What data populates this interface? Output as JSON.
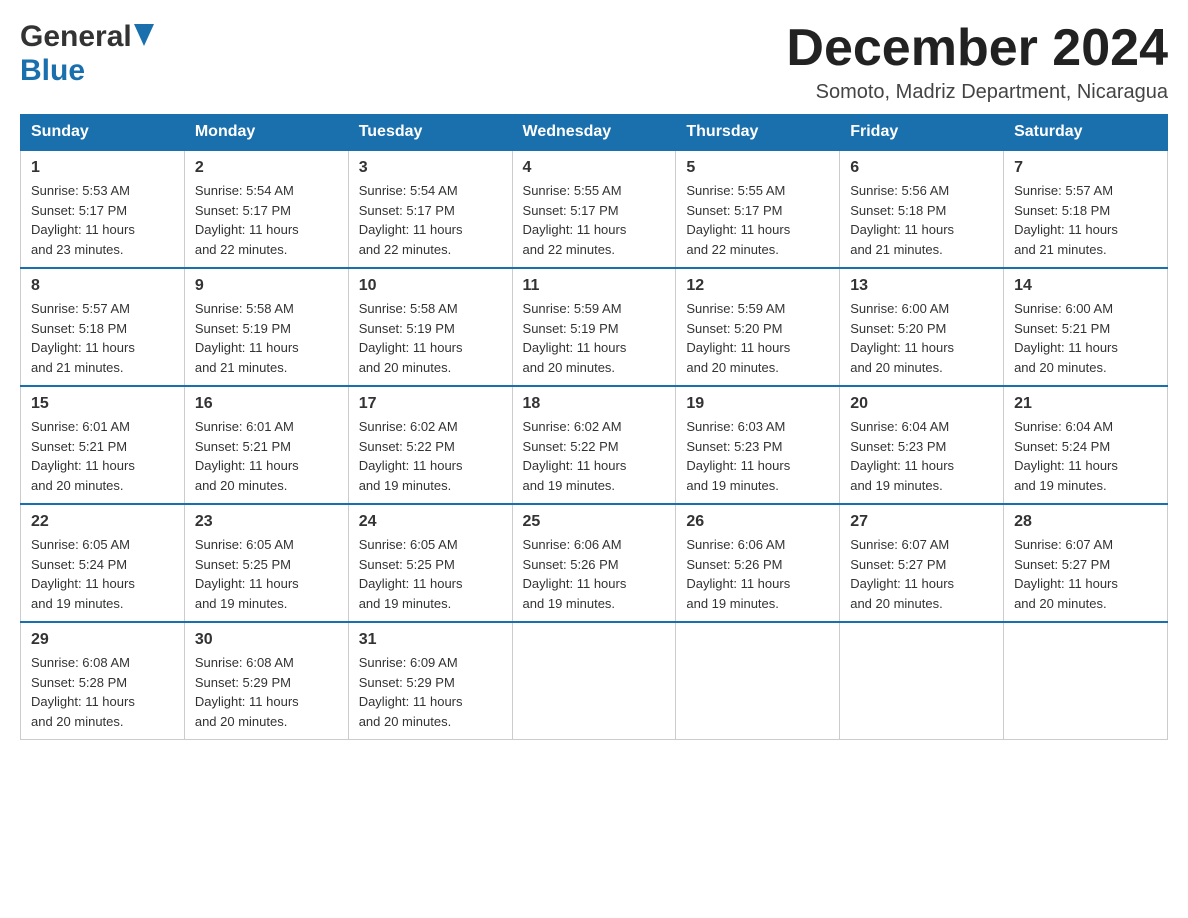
{
  "header": {
    "logo_general": "General",
    "logo_blue": "Blue",
    "month_title": "December 2024",
    "location": "Somoto, Madriz Department, Nicaragua"
  },
  "days_of_week": [
    "Sunday",
    "Monday",
    "Tuesday",
    "Wednesday",
    "Thursday",
    "Friday",
    "Saturday"
  ],
  "weeks": [
    [
      {
        "day": "1",
        "sunrise": "5:53 AM",
        "sunset": "5:17 PM",
        "daylight": "11 hours and 23 minutes."
      },
      {
        "day": "2",
        "sunrise": "5:54 AM",
        "sunset": "5:17 PM",
        "daylight": "11 hours and 22 minutes."
      },
      {
        "day": "3",
        "sunrise": "5:54 AM",
        "sunset": "5:17 PM",
        "daylight": "11 hours and 22 minutes."
      },
      {
        "day": "4",
        "sunrise": "5:55 AM",
        "sunset": "5:17 PM",
        "daylight": "11 hours and 22 minutes."
      },
      {
        "day": "5",
        "sunrise": "5:55 AM",
        "sunset": "5:17 PM",
        "daylight": "11 hours and 22 minutes."
      },
      {
        "day": "6",
        "sunrise": "5:56 AM",
        "sunset": "5:18 PM",
        "daylight": "11 hours and 21 minutes."
      },
      {
        "day": "7",
        "sunrise": "5:57 AM",
        "sunset": "5:18 PM",
        "daylight": "11 hours and 21 minutes."
      }
    ],
    [
      {
        "day": "8",
        "sunrise": "5:57 AM",
        "sunset": "5:18 PM",
        "daylight": "11 hours and 21 minutes."
      },
      {
        "day": "9",
        "sunrise": "5:58 AM",
        "sunset": "5:19 PM",
        "daylight": "11 hours and 21 minutes."
      },
      {
        "day": "10",
        "sunrise": "5:58 AM",
        "sunset": "5:19 PM",
        "daylight": "11 hours and 20 minutes."
      },
      {
        "day": "11",
        "sunrise": "5:59 AM",
        "sunset": "5:19 PM",
        "daylight": "11 hours and 20 minutes."
      },
      {
        "day": "12",
        "sunrise": "5:59 AM",
        "sunset": "5:20 PM",
        "daylight": "11 hours and 20 minutes."
      },
      {
        "day": "13",
        "sunrise": "6:00 AM",
        "sunset": "5:20 PM",
        "daylight": "11 hours and 20 minutes."
      },
      {
        "day": "14",
        "sunrise": "6:00 AM",
        "sunset": "5:21 PM",
        "daylight": "11 hours and 20 minutes."
      }
    ],
    [
      {
        "day": "15",
        "sunrise": "6:01 AM",
        "sunset": "5:21 PM",
        "daylight": "11 hours and 20 minutes."
      },
      {
        "day": "16",
        "sunrise": "6:01 AM",
        "sunset": "5:21 PM",
        "daylight": "11 hours and 20 minutes."
      },
      {
        "day": "17",
        "sunrise": "6:02 AM",
        "sunset": "5:22 PM",
        "daylight": "11 hours and 19 minutes."
      },
      {
        "day": "18",
        "sunrise": "6:02 AM",
        "sunset": "5:22 PM",
        "daylight": "11 hours and 19 minutes."
      },
      {
        "day": "19",
        "sunrise": "6:03 AM",
        "sunset": "5:23 PM",
        "daylight": "11 hours and 19 minutes."
      },
      {
        "day": "20",
        "sunrise": "6:04 AM",
        "sunset": "5:23 PM",
        "daylight": "11 hours and 19 minutes."
      },
      {
        "day": "21",
        "sunrise": "6:04 AM",
        "sunset": "5:24 PM",
        "daylight": "11 hours and 19 minutes."
      }
    ],
    [
      {
        "day": "22",
        "sunrise": "6:05 AM",
        "sunset": "5:24 PM",
        "daylight": "11 hours and 19 minutes."
      },
      {
        "day": "23",
        "sunrise": "6:05 AM",
        "sunset": "5:25 PM",
        "daylight": "11 hours and 19 minutes."
      },
      {
        "day": "24",
        "sunrise": "6:05 AM",
        "sunset": "5:25 PM",
        "daylight": "11 hours and 19 minutes."
      },
      {
        "day": "25",
        "sunrise": "6:06 AM",
        "sunset": "5:26 PM",
        "daylight": "11 hours and 19 minutes."
      },
      {
        "day": "26",
        "sunrise": "6:06 AM",
        "sunset": "5:26 PM",
        "daylight": "11 hours and 19 minutes."
      },
      {
        "day": "27",
        "sunrise": "6:07 AM",
        "sunset": "5:27 PM",
        "daylight": "11 hours and 20 minutes."
      },
      {
        "day": "28",
        "sunrise": "6:07 AM",
        "sunset": "5:27 PM",
        "daylight": "11 hours and 20 minutes."
      }
    ],
    [
      {
        "day": "29",
        "sunrise": "6:08 AM",
        "sunset": "5:28 PM",
        "daylight": "11 hours and 20 minutes."
      },
      {
        "day": "30",
        "sunrise": "6:08 AM",
        "sunset": "5:29 PM",
        "daylight": "11 hours and 20 minutes."
      },
      {
        "day": "31",
        "sunrise": "6:09 AM",
        "sunset": "5:29 PM",
        "daylight": "11 hours and 20 minutes."
      },
      null,
      null,
      null,
      null
    ]
  ],
  "labels": {
    "sunrise": "Sunrise:",
    "sunset": "Sunset:",
    "daylight": "Daylight:"
  }
}
